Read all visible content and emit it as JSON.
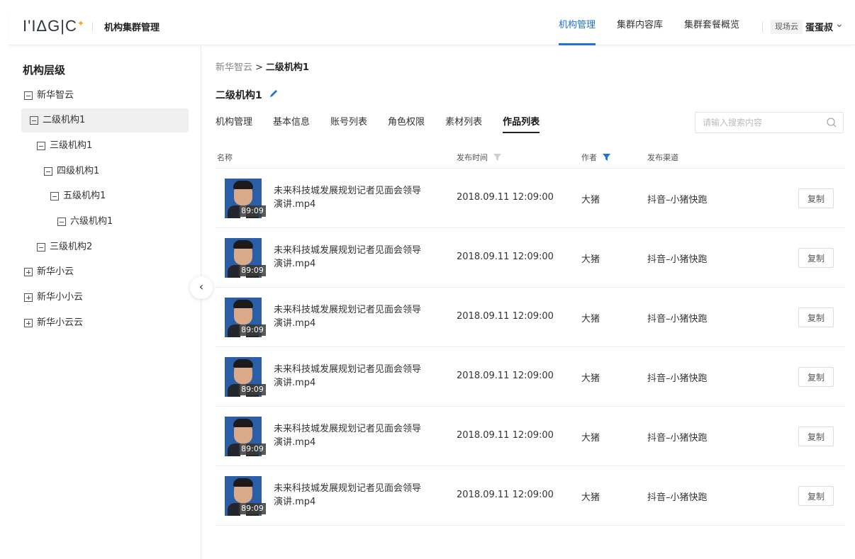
{
  "header": {
    "logo_text": "I'IΔG|C",
    "app_title": "机构集群管理",
    "nav": [
      "机构管理",
      "集群内容库",
      "集群套餐概览"
    ],
    "active_nav_index": 0,
    "tenant_tag": "现场云",
    "user_name": "蛋蛋叔"
  },
  "sidebar": {
    "title": "机构层级",
    "tree": [
      {
        "label": "新华智云",
        "expanded": true,
        "level": 0
      },
      {
        "label": "二级机构1",
        "expanded": true,
        "level": 1,
        "active": true
      },
      {
        "label": "三级机构1",
        "expanded": true,
        "level": 2
      },
      {
        "label": "四级机构1",
        "expanded": true,
        "level": 3
      },
      {
        "label": "五级机构1",
        "expanded": true,
        "level": 4
      },
      {
        "label": "六级机构1",
        "expanded": true,
        "level": 5
      },
      {
        "label": "三级机构2",
        "expanded": true,
        "level": 2
      },
      {
        "label": "新华小云",
        "expanded": false,
        "level": 0
      },
      {
        "label": "新华小小云",
        "expanded": false,
        "level": 0
      },
      {
        "label": "新华小云云",
        "expanded": false,
        "level": 0
      }
    ]
  },
  "breadcrumb": {
    "root": "新华智云",
    "sep": ">",
    "current": "二级机构1"
  },
  "page_title": "二级机构1",
  "tabs": [
    "机构管理",
    "基本信息",
    "账号列表",
    "角色权限",
    "素材列表",
    "作品列表"
  ],
  "active_tab_index": 5,
  "search": {
    "placeholder": "请输入搜索内容",
    "value": ""
  },
  "table": {
    "columns": {
      "name": "名称",
      "time": "发布时间",
      "author": "作者",
      "channel": "发布渠道"
    },
    "rows": [
      {
        "name": "未来科技城发展规划记者见面会领导演讲.mp4",
        "duration": "89:09",
        "time": "2018.09.11 12:09:00",
        "author": "大猪",
        "channel": "抖音–小猪快跑",
        "action": "复制"
      },
      {
        "name": "未来科技城发展规划记者见面会领导演讲.mp4",
        "duration": "89:09",
        "time": "2018.09.11 12:09:00",
        "author": "大猪",
        "channel": "抖音–小猪快跑",
        "action": "复制"
      },
      {
        "name": "未来科技城发展规划记者见面会领导演讲.mp4",
        "duration": "89:09",
        "time": "2018.09.11 12:09:00",
        "author": "大猪",
        "channel": "抖音–小猪快跑",
        "action": "复制"
      },
      {
        "name": "未来科技城发展规划记者见面会领导演讲.mp4",
        "duration": "89:09",
        "time": "2018.09.11 12:09:00",
        "author": "大猪",
        "channel": "抖音–小猪快跑",
        "action": "复制"
      },
      {
        "name": "未来科技城发展规划记者见面会领导演讲.mp4",
        "duration": "89:09",
        "time": "2018.09.11 12:09:00",
        "author": "大猪",
        "channel": "抖音–小猪快跑",
        "action": "复制"
      },
      {
        "name": "未来科技城发展规划记者见面会领导演讲.mp4",
        "duration": "89:09",
        "time": "2018.09.11 12:09:00",
        "author": "大猪",
        "channel": "抖音–小猪快跑",
        "action": "复制"
      }
    ]
  },
  "colors": {
    "accent": "#1f6fe5",
    "logo_star": "#f5a623"
  },
  "icons": [
    "edit-icon",
    "search-icon",
    "filter-icon",
    "collapse-chevron-icon",
    "chevron-down-icon"
  ]
}
